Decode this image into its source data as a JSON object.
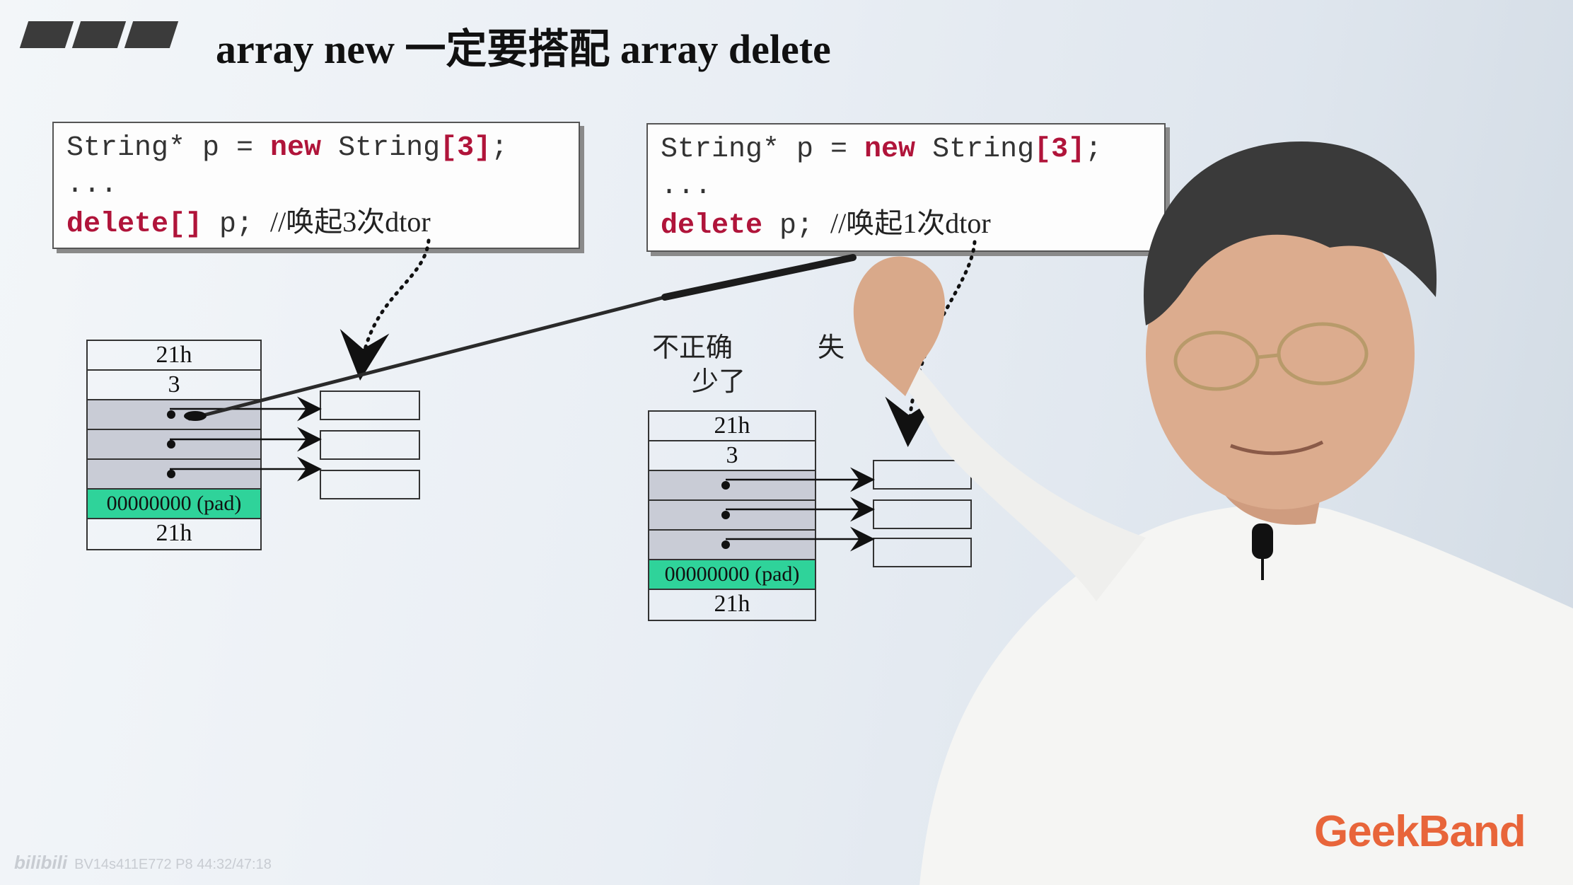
{
  "slide": {
    "title": "array new 一定要搭配 array delete",
    "left_code": {
      "line1_a": "String* p = ",
      "line1_kw": "new",
      "line1_b": " String",
      "line1_br": "[3]",
      "line1_c": ";",
      "line2": "...",
      "line3_kw": "delete[]",
      "line3_b": " p; ",
      "line3_cmt": "//唤起3次dtor"
    },
    "right_code": {
      "line1_a": "String* p = ",
      "line1_kw": "new",
      "line1_b": " String",
      "line1_br": "[3]",
      "line1_c": ";",
      "line2": "...",
      "line3_kw": "delete",
      "line3_b": " p; ",
      "line3_cmt": "//唤起1次dtor"
    },
    "left_memory": [
      "21h",
      "3",
      "",
      "",
      "",
      "00000000 (pad)",
      "21h"
    ],
    "right_memory": [
      "21h",
      "3",
      "",
      "",
      "",
      "00000000 (pad)",
      "21h"
    ],
    "note_line1": "不正确",
    "note_line2": "少了",
    "note_line1_tail": "失"
  },
  "branding": {
    "logo": "GeekBand",
    "watermark_site": "bilibili",
    "watermark_id": "BV14s411E772 P8 44:32/47:18"
  },
  "colors": {
    "keyword": "#b0143a",
    "pad": "#2fd39a",
    "pointer_cell": "#c9ccd6",
    "logo": "#e8653a"
  }
}
